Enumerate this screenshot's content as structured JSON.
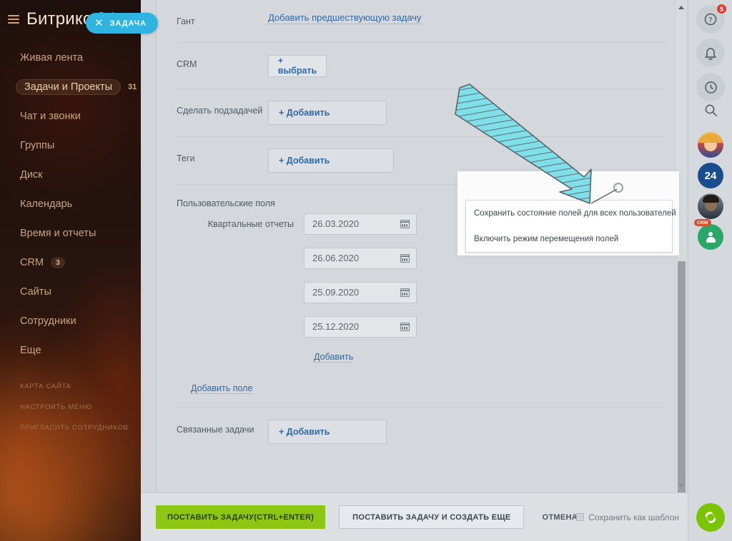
{
  "sidebar": {
    "logo": "Битрикс 24",
    "task_pill": {
      "close": "✕",
      "label": "ЗАДАЧА"
    },
    "items": [
      {
        "label": "Живая лента",
        "badge": "",
        "active": false
      },
      {
        "label": "Задачи и Проекты",
        "badge": "31",
        "active": true
      },
      {
        "label": "Чат и звонки",
        "badge": "",
        "active": false
      },
      {
        "label": "Группы",
        "badge": "",
        "active": false
      },
      {
        "label": "Диск",
        "badge": "",
        "active": false
      },
      {
        "label": "Календарь",
        "badge": "",
        "active": false
      },
      {
        "label": "Время и отчеты",
        "badge": "",
        "active": false
      },
      {
        "label": "CRM",
        "badge": "3",
        "active": false
      },
      {
        "label": "Сайты",
        "badge": "",
        "active": false
      },
      {
        "label": "Сотрудники",
        "badge": "",
        "active": false
      },
      {
        "label": "Еще",
        "badge": "",
        "active": false
      }
    ],
    "sub_items": [
      {
        "label": "КАРТА САЙТА"
      },
      {
        "label": "НАСТРОИТЬ МЕНЮ"
      },
      {
        "label": "ПРИГЛАСИТЬ СОТРУДНИКОВ"
      }
    ]
  },
  "form": {
    "gantt": {
      "label": "Гант",
      "link": "Добавить предшествующую задачу"
    },
    "crm": {
      "label": "CRM",
      "button": "+  выбрать"
    },
    "subtask": {
      "label": "Сделать подзадачей",
      "button": "+ Добавить"
    },
    "tags": {
      "label": "Теги",
      "button": "+ Добавить"
    },
    "user_fields": {
      "label": "Пользовательские поля",
      "group_label": "Квартальные отчеты",
      "dates": [
        "26.03.2020",
        "26.06.2020",
        "25.09.2020",
        "25.12.2020"
      ],
      "add_value_link": "Добавить",
      "add_field_link": "Добавить поле"
    },
    "related": {
      "label": "Связанные задачи",
      "button": "+ Добавить"
    }
  },
  "footer": {
    "primary": "ПОСТАВИТЬ ЗАДАЧУ(CTRL+ENTER)",
    "secondary": "ПОСТАВИТЬ ЗАДАЧУ И СОЗДАТЬ ЕЩЕ",
    "cancel": "ОТМЕНА",
    "template_checkbox": "Сохранить как шаблон"
  },
  "context_menu": {
    "items": [
      "Сохранить состояние полей для всех пользователей",
      "Включить режим перемещения полей"
    ]
  },
  "rail": {
    "help_badge": "5",
    "bitrix24_avatar": "24",
    "crm_tag": "CRM"
  },
  "colors": {
    "accent_blue": "#2fb3e0",
    "primary_green": "#8dc714",
    "link_blue": "#2f69a8",
    "badge_red": "#e8382d",
    "annotation_cyan": "#7fe0ea"
  }
}
